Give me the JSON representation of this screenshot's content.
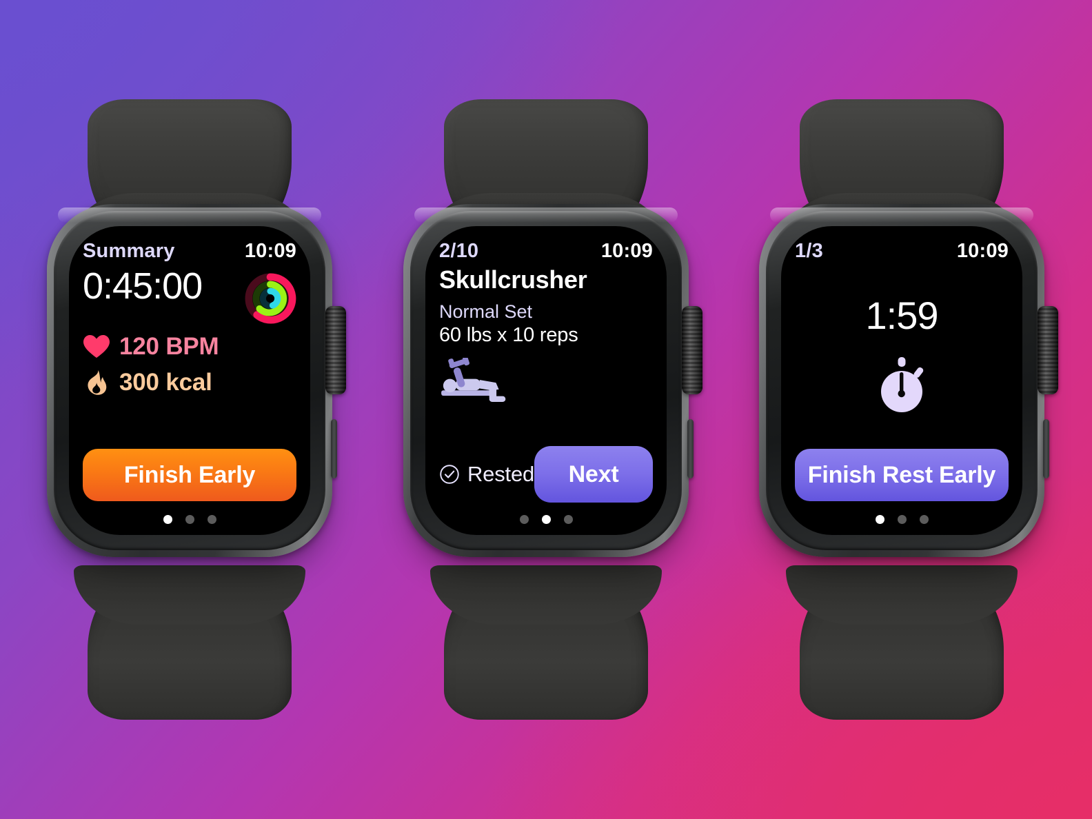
{
  "background": {
    "gradient_from": "#6a4fce",
    "gradient_to": "#e22f6a"
  },
  "theme": {
    "screen_bg": "#000000",
    "accent_purple": "#7d6fe9",
    "accent_orange": "#fa7a14",
    "lavender_text": "#ded9fb",
    "bpm_color": "#f7839f",
    "kcal_color": "#fbcb9d",
    "ring_move": "#f8185c",
    "ring_exercise": "#9bf216",
    "ring_stand": "#24d6 e0"
  },
  "watches": [
    {
      "id": "summary",
      "status": {
        "left": "Summary",
        "time": "10:09"
      },
      "duration": "0:45:00",
      "rings_icon": "activity-rings-icon",
      "metrics": [
        {
          "icon": "heart-icon",
          "value": "120 BPM",
          "color": "#f7839f"
        },
        {
          "icon": "flame-icon",
          "value": "300 kcal",
          "color": "#fbcb9d"
        }
      ],
      "primary_button": {
        "label": "Finish Early",
        "style": "orange"
      },
      "page_dots": {
        "count": 3,
        "active": 0
      }
    },
    {
      "id": "exercise",
      "status": {
        "left": "2/10",
        "time": "10:09"
      },
      "exercise_name": "Skullcrusher",
      "set_type": "Normal Set",
      "set_detail": "60 lbs x 10 reps",
      "exercise_icon": "skullcrusher-figure-icon",
      "rested": {
        "icon": "check-circle-icon",
        "label": "Rested"
      },
      "primary_button": {
        "label": "Next",
        "style": "purple"
      },
      "page_dots": {
        "count": 3,
        "active": 1
      }
    },
    {
      "id": "rest",
      "status": {
        "left": "1/3",
        "time": "10:09"
      },
      "rest_timer": "1:59",
      "timer_icon": "stopwatch-icon",
      "primary_button": {
        "label": "Finish Rest Early",
        "style": "purple"
      },
      "page_dots": {
        "count": 3,
        "active": 0
      }
    }
  ]
}
